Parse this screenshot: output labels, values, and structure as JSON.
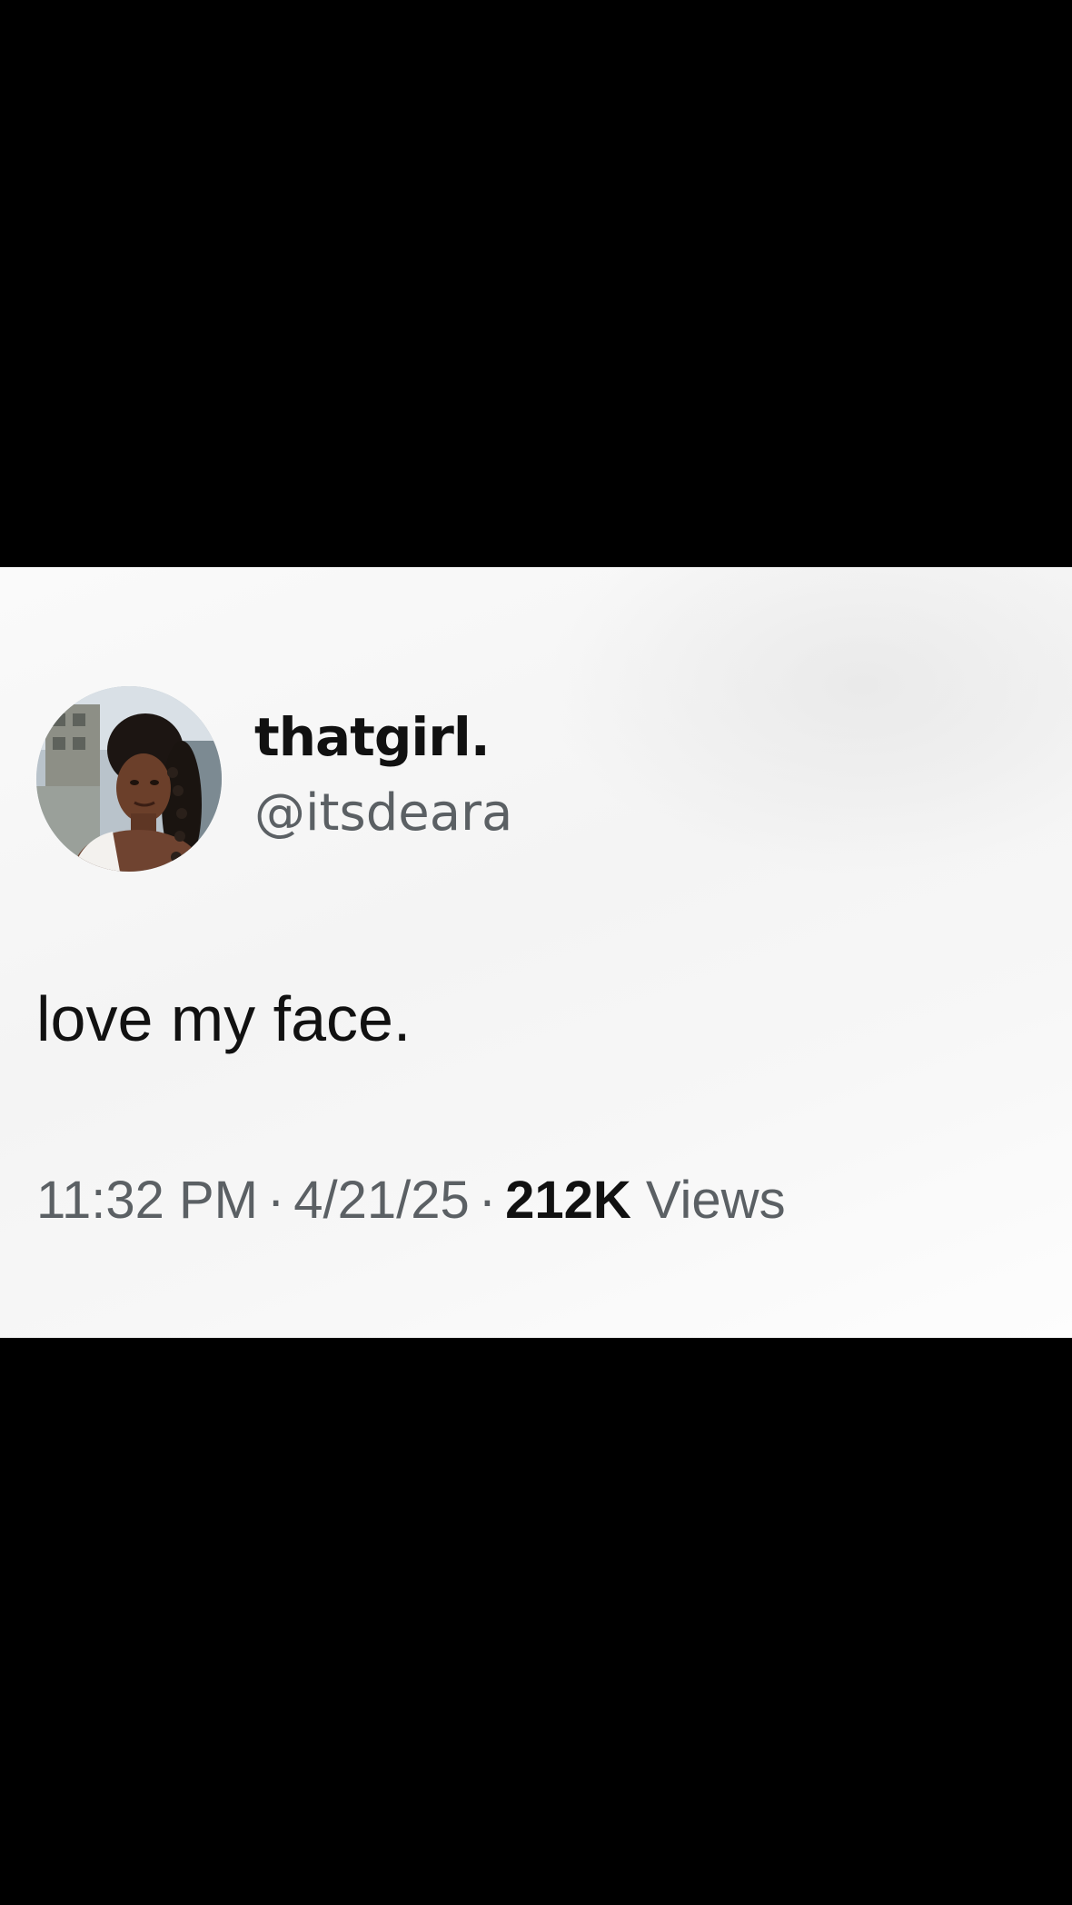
{
  "tweet": {
    "display_name": "thatgirl.",
    "handle": "@itsdeara",
    "text": "love my face.",
    "time": "11:32 PM",
    "separator": "·",
    "date": "4/21/25",
    "views_count": "212K",
    "views_label": "Views"
  },
  "colors": {
    "letterbox": "#000000",
    "card_background": "#f7f7f7",
    "primary_text": "#111111",
    "secondary_text": "#5b6064"
  },
  "icons": {
    "avatar": "profile-photo"
  }
}
